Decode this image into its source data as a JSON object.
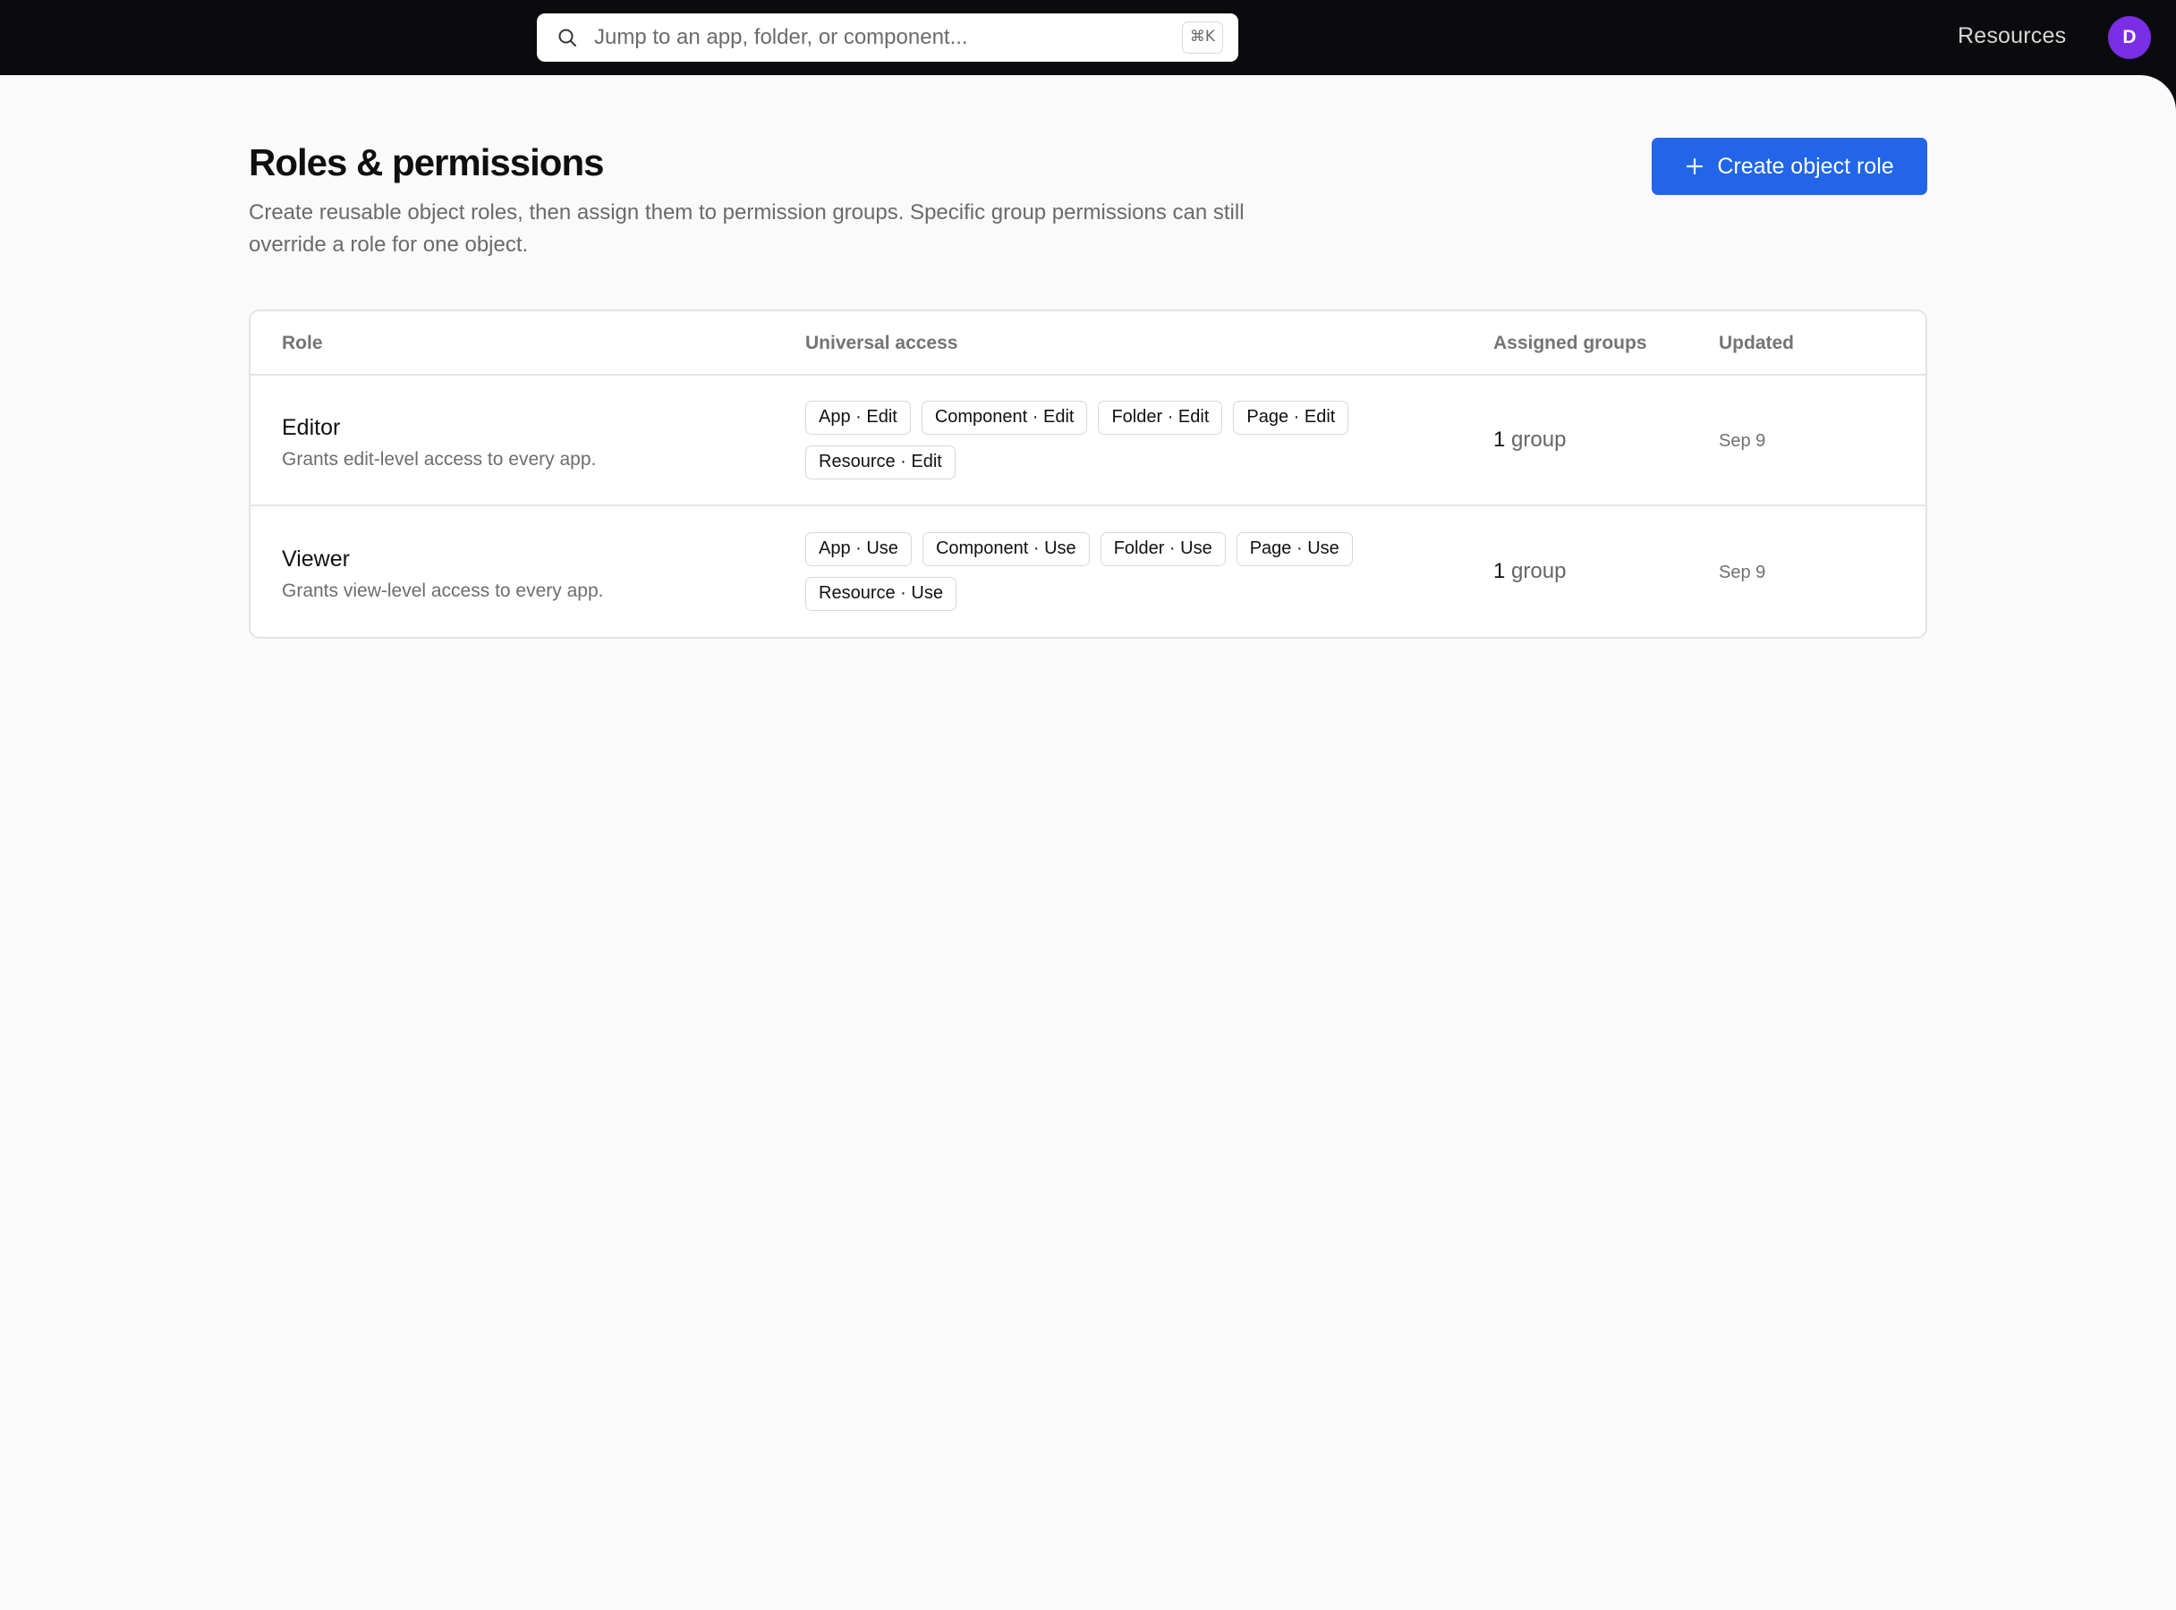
{
  "topbar": {
    "search_placeholder": "Jump to an app, folder, or component...",
    "shortcut": "⌘K",
    "resources_label": "Resources",
    "avatar_initial": "D",
    "avatar_color": "#7a2ee6"
  },
  "page": {
    "title": "Roles & permissions",
    "description": "Create reusable object roles, then assign them to permission groups. Specific group permissions can still override a role for one object.",
    "create_button_label": "Create object role",
    "accent_color": "#2265e8"
  },
  "table": {
    "headers": {
      "role": "Role",
      "universal_access": "Universal access",
      "assigned_groups": "Assigned groups",
      "updated": "Updated"
    },
    "rows": [
      {
        "name": "Editor",
        "description": "Grants edit-level access to every app.",
        "access": [
          "App · Edit",
          "Component · Edit",
          "Folder · Edit",
          "Page · Edit",
          "Resource · Edit"
        ],
        "groups_count": "1",
        "groups_unit": "group",
        "updated": "Sep 9"
      },
      {
        "name": "Viewer",
        "description": "Grants view-level access to every app.",
        "access": [
          "App · Use",
          "Component · Use",
          "Folder · Use",
          "Page · Use",
          "Resource · Use"
        ],
        "groups_count": "1",
        "groups_unit": "group",
        "updated": "Sep 9"
      }
    ]
  }
}
